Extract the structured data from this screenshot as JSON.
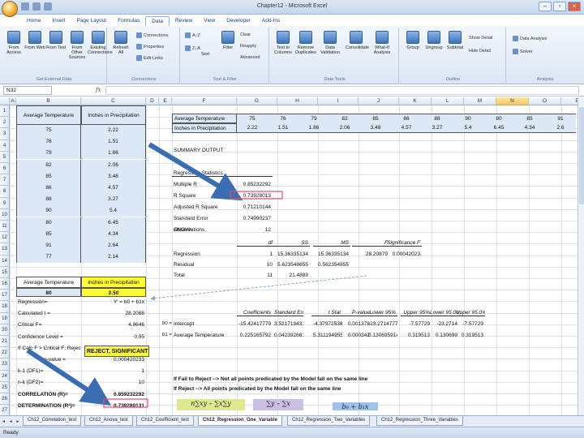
{
  "window": {
    "title": "Chapter12 - Microsoft Excel"
  },
  "ribbon": {
    "tabs": [
      "Home",
      "Insert",
      "Page Layout",
      "Formulas",
      "Data",
      "Review",
      "View",
      "Developer",
      "Add-Ins"
    ],
    "active_tab": "Data",
    "groups": {
      "external": {
        "label": "Get External Data",
        "buttons": [
          "From Access",
          "From Web",
          "From Text",
          "From Other Sources"
        ],
        "existing": "Existing Connections"
      },
      "connections": {
        "label": "Connections",
        "refresh": "Refresh All",
        "items": [
          "Connections",
          "Properties",
          "Edit Links"
        ]
      },
      "sort_filter": {
        "label": "Sort & Filter",
        "sort": "Sort",
        "filter": "Filter",
        "items": [
          "Clear",
          "Reapply",
          "Advanced"
        ]
      },
      "data_tools": {
        "label": "Data Tools",
        "buttons": [
          "Text to Columns",
          "Remove Duplicates",
          "Data Validation",
          "Consolidate",
          "What-If Analysis"
        ]
      },
      "outline": {
        "label": "Outline",
        "buttons": [
          "Group",
          "Ungroup",
          "Subtotal"
        ],
        "items": [
          "Show Detail",
          "Hide Detail"
        ]
      },
      "analysis": {
        "label": "Analysis",
        "items": [
          "Data Analysis",
          "Solver"
        ]
      }
    }
  },
  "formula_bar": {
    "name_box": "N32",
    "fx": "fx",
    "value": ""
  },
  "columns": [
    "A",
    "B",
    "C",
    "D",
    "E",
    "F",
    "G",
    "H",
    "I",
    "J",
    "K",
    "L",
    "M",
    "N",
    "O",
    "P"
  ],
  "selected_column": "N",
  "rows": [
    "1",
    "2",
    "3",
    "4",
    "5",
    "6",
    "7",
    "8",
    "9",
    "10",
    "11",
    "12",
    "13",
    "14",
    "15",
    "16",
    "17",
    "18",
    "19",
    "20",
    "21",
    "22",
    "23",
    "24",
    "25",
    "26",
    "27",
    "28"
  ],
  "data_table": {
    "headers": [
      "Average Temperature",
      "Inches in Precipitation"
    ],
    "temps": [
      "75",
      "76",
      "79",
      "82",
      "85",
      "86",
      "88",
      "90",
      "80",
      "85",
      "91",
      "77"
    ],
    "precip": [
      "2.22",
      "1.51",
      "1.86",
      "2.06",
      "3.48",
      "4.57",
      "3.27",
      "5.4",
      "6.45",
      "4.34",
      "2.64",
      "2.14"
    ]
  },
  "transposed": {
    "label_temp": "Average Temperature",
    "label_precip": "Inches in Precipitation",
    "temps": [
      "75",
      "76",
      "79",
      "82",
      "85",
      "86",
      "88",
      "90",
      "80",
      "85",
      "91"
    ],
    "precip": [
      "2.22",
      "1.51",
      "1.86",
      "2.06",
      "3.48",
      "4.57",
      "3.27",
      "5.4",
      "6.45",
      "4.34",
      "2.6"
    ]
  },
  "summary": {
    "title": "SUMMARY OUTPUT",
    "reg_stats": "Regression Statistics",
    "labels": [
      "Multiple R",
      "R Square",
      "Adjusted R Square",
      "Standard Error",
      "Observations"
    ],
    "values": [
      "0.85232292",
      "0.73928013",
      "0.71210144",
      "0.74990237",
      "12"
    ]
  },
  "anova": {
    "title": "ANOVA",
    "headers": [
      "df",
      "SS",
      "MS",
      "F",
      "Significance F"
    ],
    "rows": [
      {
        "label": "Regression",
        "df": "1",
        "ss": "15.36335134",
        "ms": "15.36335134",
        "f": "28.20879",
        "sig": "0.00042023"
      },
      {
        "label": "Residual",
        "df": "10",
        "ss": "5.623548655",
        "ms": "0.562354855",
        "f": "",
        "sig": ""
      },
      {
        "label": "Total",
        "df": "11",
        "ss": "21.4889",
        "ms": "",
        "f": "",
        "sig": ""
      }
    ]
  },
  "coef": {
    "headers": [
      "Coefficients",
      "Standard Error",
      "t Stat",
      "P-value",
      "Lower 95%",
      "Upper 95%",
      "Lower 95.0%",
      "Upper 95.0%"
    ],
    "rows": [
      {
        "prefix": "b0 =",
        "label": "Intercept",
        "vals": [
          "-15.42417779",
          "3.521719431",
          "-4.379725385",
          "0.001378",
          "-23.2714777",
          "-7.57729",
          "-23.2714",
          "-7.57729"
        ]
      },
      {
        "prefix": "b1 =",
        "label": "Average Temperature",
        "vals": [
          "0.225165792",
          "0.042392681",
          "5.311194955",
          "0.000342",
          "0.130695914",
          "0.319513",
          "0.130699",
          "0.319513"
        ]
      }
    ]
  },
  "calc": {
    "header_temp": "Average Temperature",
    "header_precip": "Inches in Precipitation",
    "temp": "80",
    "precip": "2.50",
    "regression_label": "Regression=",
    "regression_value": "Y' = b0 + b1x",
    "calculated_label": "Calculated t =",
    "calculated_value": "28.2088",
    "critical_label": "Critical F=",
    "critical_value": "4.9646",
    "confidence_label": "Confidence Level =",
    "confidence_value": "0.95",
    "decision_label": "If Calc F > Critical F: Reject",
    "decision_value": "REJECT, SIGNIFICANT",
    "pvalue_label": "p-value =",
    "pvalue_value": "0.000420233",
    "k1_label": "k-1 (DF1)=",
    "k1_value": "1",
    "nk_label": "n-k (DF2)=",
    "nk_value": "10",
    "corr_label": "CORRELATION (R)=",
    "corr_value": "0.859232292",
    "det_label": "DETERMINATION (R²)=",
    "det_value": "0.738280131"
  },
  "notes": {
    "fail": "If Fail to Reject --> Not all points predicated by the Model fall on the same line",
    "reject": "If Reject --> All points predicated by the Model fall on the same line"
  },
  "sheet_tabs": [
    "Ch12_Correlation_test",
    "Ch12_Anova_test",
    "Ch12_Coefficient_test",
    "Ch12_Regression_One_Variable",
    "Ch12_Regression_Two_Variables",
    "Ch12_Regression_Three_Variables"
  ],
  "active_sheet": "Ch12_Regression_One_Variable",
  "status": {
    "ready": "Ready"
  },
  "colors": {
    "arrow": "#3b6db3",
    "selected_header": "#f6c95b",
    "highlight_yellow": "#ffff33",
    "annotation_box": "#e0506a"
  }
}
